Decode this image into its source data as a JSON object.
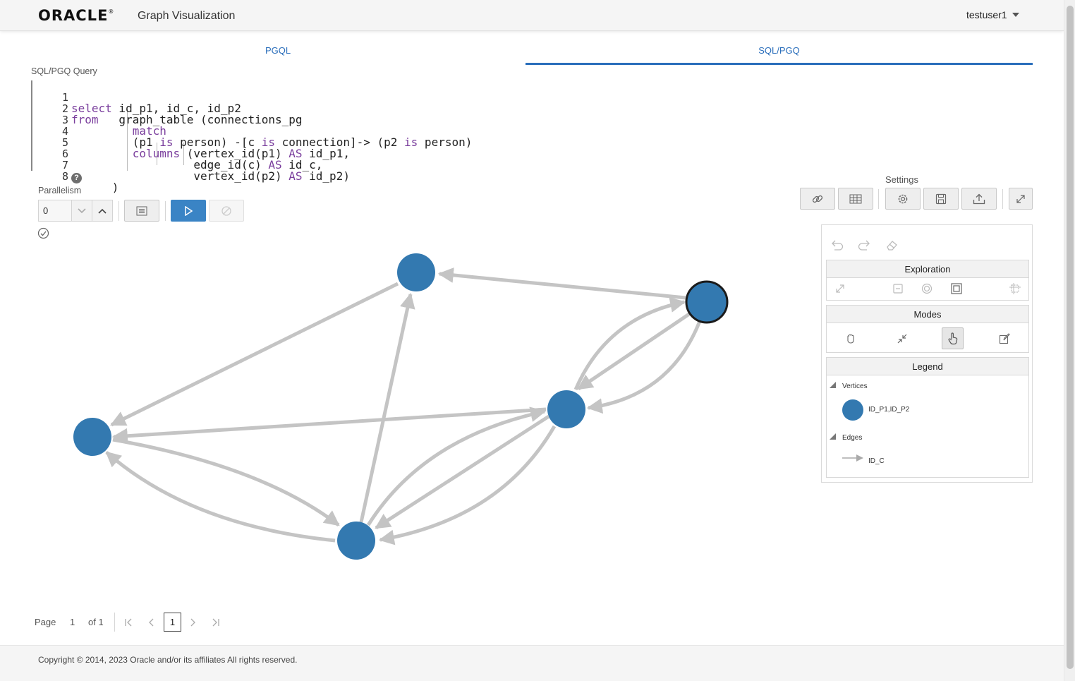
{
  "header": {
    "logo_text": "ORACLE",
    "logo_mark": "®",
    "app_title": "Graph Visualization",
    "user": "testuser1"
  },
  "tabs": [
    {
      "label": "PGQL",
      "active": false
    },
    {
      "label": "SQL/PGQ",
      "active": true
    }
  ],
  "query": {
    "label": "SQL/PGQ Query",
    "lines": [
      {
        "num": "1",
        "text": "select id_p1, id_c, id_p2"
      },
      {
        "num": "2",
        "text": "from   graph_table (connections_pg"
      },
      {
        "num": "3",
        "text": "         match"
      },
      {
        "num": "4",
        "text": "         (p1 is person) -[c is connection]-> (p2 is person)"
      },
      {
        "num": "5",
        "text": "         columns (vertex_id(p1) AS id_p1,"
      },
      {
        "num": "6",
        "text": "                  edge_id(c) AS id_c,"
      },
      {
        "num": "7",
        "text": "                  vertex_id(p2) AS id_p2)"
      },
      {
        "num": "8",
        "text": "      )"
      }
    ]
  },
  "controls": {
    "parallelism_label": "Parallelism",
    "parallelism_value": "0"
  },
  "settings": {
    "label": "Settings"
  },
  "panel": {
    "exploration_label": "Exploration",
    "modes_label": "Modes",
    "legend_label": "Legend",
    "legend_vertices_label": "Vertices",
    "legend_vertex_item": "ID_P1,ID_P2",
    "legend_edges_label": "Edges",
    "legend_edge_item": "ID_C"
  },
  "colors": {
    "vertex": "#3379b0",
    "edge": "#c4c4c4",
    "accent": "#2a6ebb",
    "primary_button": "#3a84c5"
  },
  "pagination": {
    "page_label": "Page",
    "page_number": "1",
    "of_label": "of 1",
    "current": "1"
  },
  "footer": {
    "copyright": "Copyright © 2014, 2023 Oracle and/or its affiliates All rights reserved."
  }
}
